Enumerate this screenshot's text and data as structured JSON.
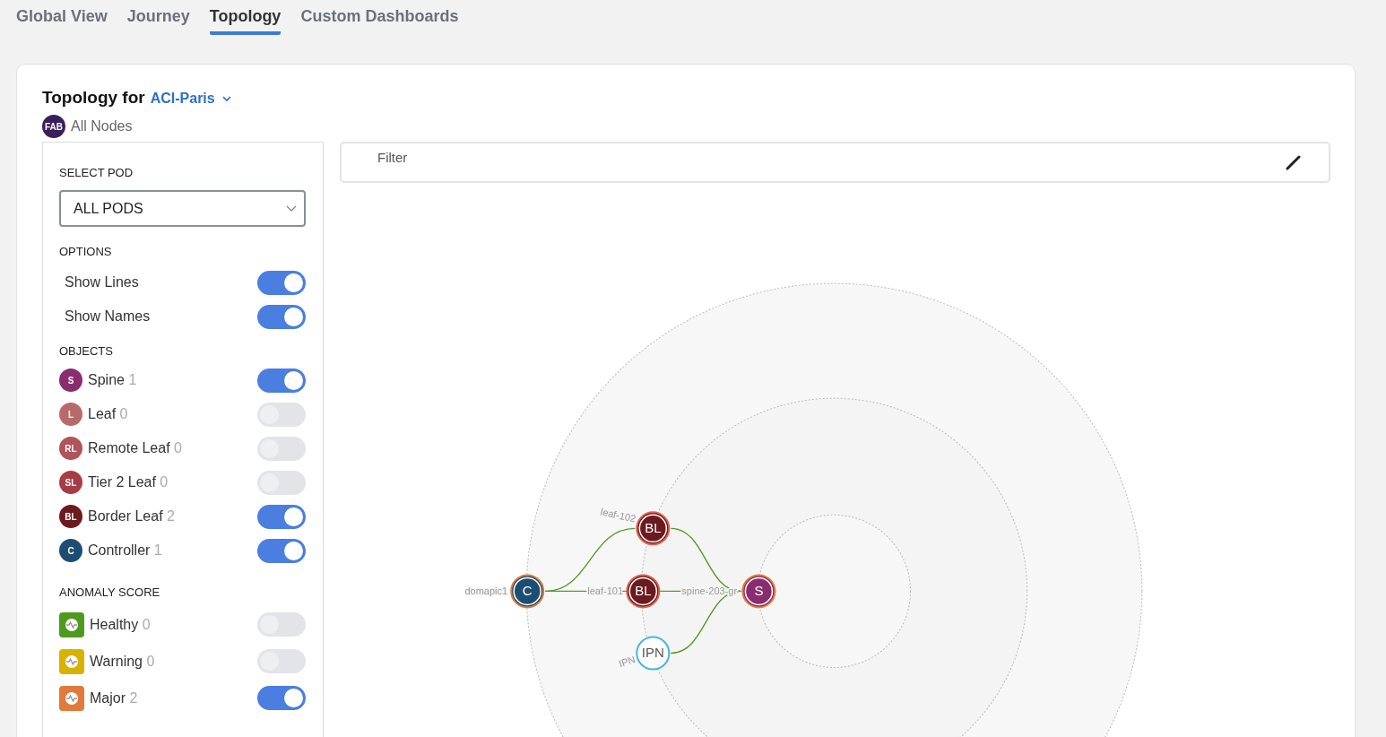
{
  "tabs": [
    {
      "label": "Global View",
      "selected": false
    },
    {
      "label": "Journey",
      "selected": false
    },
    {
      "label": "Topology",
      "selected": true
    },
    {
      "label": "Custom Dashboards",
      "selected": false
    }
  ],
  "header": {
    "title": "Topology for",
    "site": "ACI-Paris",
    "scope_badge": "FAB",
    "scope": "All Nodes"
  },
  "pod": {
    "heading": "SELECT POD",
    "value": "ALL PODS"
  },
  "options": {
    "heading": "OPTIONS",
    "items": [
      {
        "label": "Show Lines",
        "on": true
      },
      {
        "label": "Show Names",
        "on": true
      }
    ]
  },
  "objects": {
    "heading": "OBJECTS",
    "items": [
      {
        "badge": "S",
        "label": "Spine",
        "count": "1",
        "color": "#8a2d6e",
        "on": true
      },
      {
        "badge": "L",
        "label": "Leaf",
        "count": "0",
        "color": "#b86a6a",
        "on": false
      },
      {
        "badge": "RL",
        "label": "Remote Leaf",
        "count": "0",
        "color": "#b0545a",
        "on": false
      },
      {
        "badge": "SL",
        "label": "Tier 2 Leaf",
        "count": "0",
        "color": "#a83c44",
        "on": false
      },
      {
        "badge": "BL",
        "label": "Border Leaf",
        "count": "2",
        "color": "#6b1a1f",
        "on": true
      },
      {
        "badge": "C",
        "label": "Controller",
        "count": "1",
        "color": "#1d4e72",
        "on": true
      }
    ]
  },
  "anomaly": {
    "heading": "ANOMALY SCORE",
    "items": [
      {
        "label": "Healthy",
        "count": "0",
        "color": "#4e9a1e",
        "on": false
      },
      {
        "label": "Warning",
        "count": "0",
        "color": "#d6b300",
        "on": false
      },
      {
        "label": "Major",
        "count": "2",
        "color": "#e07b3c",
        "on": true
      }
    ]
  },
  "filter": {
    "placeholder": "Filter"
  },
  "graph": {
    "nodes": [
      {
        "kind": "controller",
        "label": "C",
        "name": "domapic1"
      },
      {
        "kind": "border_leaf",
        "label": "BL",
        "name": "leaf-102"
      },
      {
        "kind": "border_leaf",
        "label": "BL",
        "name": "leaf-101"
      },
      {
        "kind": "spine",
        "label": "S",
        "name": "spine-203-gr"
      },
      {
        "kind": "ipn",
        "label": "IPN",
        "name": "IPN"
      }
    ]
  }
}
